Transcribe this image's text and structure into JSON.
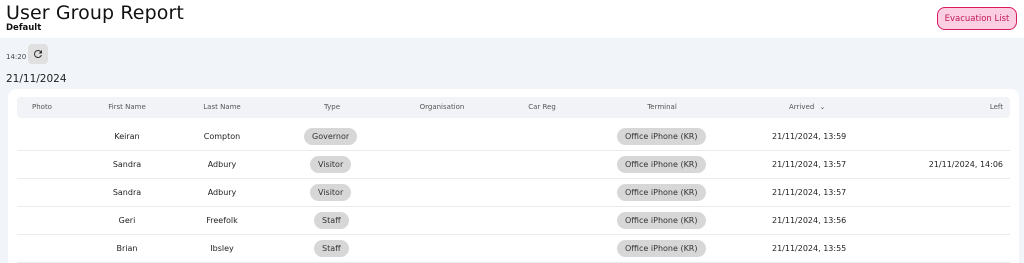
{
  "header": {
    "title": "User Group Report",
    "subtitle": "Default",
    "evacuation_label": "Evacuation List"
  },
  "toolbar": {
    "time": "14:20",
    "refresh_icon": "refresh-icon"
  },
  "date": "21/11/2024",
  "table": {
    "columns": [
      "Photo",
      "First Name",
      "Last Name",
      "Type",
      "Organisation",
      "Car Reg",
      "Terminal",
      "Arrived",
      "Left"
    ],
    "sort_indicator": "⌄",
    "rows": [
      {
        "photo": "",
        "first_name": "Keiran",
        "last_name": "Compton",
        "type": "Governor",
        "organisation": "",
        "car_reg": "",
        "terminal": "Office iPhone (KR)",
        "arrived": "21/11/2024, 13:59",
        "left": ""
      },
      {
        "photo": "",
        "first_name": "Sandra",
        "last_name": "Adbury",
        "type": "Visitor",
        "organisation": "",
        "car_reg": "",
        "terminal": "Office iPhone (KR)",
        "arrived": "21/11/2024, 13:57",
        "left": "21/11/2024, 14:06"
      },
      {
        "photo": "",
        "first_name": "Sandra",
        "last_name": "Adbury",
        "type": "Visitor",
        "organisation": "",
        "car_reg": "",
        "terminal": "Office iPhone (KR)",
        "arrived": "21/11/2024, 13:57",
        "left": ""
      },
      {
        "photo": "",
        "first_name": "Geri",
        "last_name": "Freefolk",
        "type": "Staff",
        "organisation": "",
        "car_reg": "",
        "terminal": "Office iPhone (KR)",
        "arrived": "21/11/2024, 13:56",
        "left": ""
      },
      {
        "photo": "",
        "first_name": "Brian",
        "last_name": "Ibsley",
        "type": "Staff",
        "organisation": "",
        "car_reg": "",
        "terminal": "Office iPhone (KR)",
        "arrived": "21/11/2024, 13:55",
        "left": ""
      }
    ]
  },
  "colors": {
    "page_bg": "#f1f4f9",
    "accent_pink": "#d81b60",
    "accent_pink_bg": "#fbcfe1",
    "chip_bg": "#d7d7d7"
  }
}
